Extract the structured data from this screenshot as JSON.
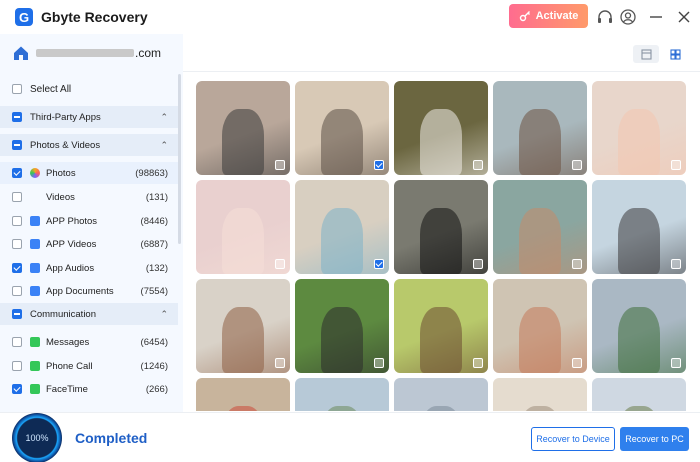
{
  "app": {
    "title": "Gbyte Recovery",
    "logo_letter": "G"
  },
  "titlebar": {
    "activate_label": "Activate",
    "icons": [
      "key-icon",
      "headset-icon",
      "user-icon",
      "minimize-icon",
      "close-icon"
    ]
  },
  "account": {
    "email_suffix": ".com"
  },
  "view": {
    "modes": [
      "list-view-icon",
      "grid-view-icon"
    ],
    "active": "grid"
  },
  "sidebar": {
    "select_all": "Select All",
    "categories": [
      {
        "label": "Third-Party Apps",
        "state": "partial",
        "expanded": true,
        "items": []
      },
      {
        "label": "Photos & Videos",
        "state": "partial",
        "expanded": true,
        "items": [
          {
            "label": "Photos",
            "count": "(98863)",
            "checked": true,
            "icon": "photos-icon",
            "color": "#f5a623"
          },
          {
            "label": "Videos",
            "count": "(131)",
            "checked": false,
            "icon": "",
            "color": ""
          },
          {
            "label": "APP Photos",
            "count": "(8446)",
            "checked": false,
            "icon": "app-photos-icon",
            "color": "#3b82f6"
          },
          {
            "label": "APP Videos",
            "count": "(6887)",
            "checked": false,
            "icon": "app-videos-icon",
            "color": "#3b82f6"
          },
          {
            "label": "App Audios",
            "count": "(132)",
            "checked": true,
            "icon": "app-audios-icon",
            "color": "#3b82f6"
          },
          {
            "label": "App Documents",
            "count": "(7554)",
            "checked": false,
            "icon": "app-documents-icon",
            "color": "#3b82f6"
          }
        ]
      },
      {
        "label": "Communication",
        "state": "partial",
        "expanded": true,
        "items": [
          {
            "label": "Messages",
            "count": "(6454)",
            "checked": false,
            "icon": "messages-icon",
            "color": "#34c759"
          },
          {
            "label": "Phone Call",
            "count": "(1246)",
            "checked": false,
            "icon": "phone-call-icon",
            "color": "#34c759"
          },
          {
            "label": "FaceTime",
            "count": "(266)",
            "checked": true,
            "icon": "facetime-icon",
            "color": "#34c759"
          }
        ]
      }
    ]
  },
  "photos": [
    {
      "checked": false,
      "bg": "#b9a79a",
      "accent": "#3b3b3b"
    },
    {
      "checked": true,
      "bg": "#d8c9b6",
      "accent": "#5b4f46"
    },
    {
      "checked": false,
      "bg": "#6b6640",
      "accent": "#f1ede7"
    },
    {
      "checked": false,
      "bg": "#a9b8bd",
      "accent": "#6d5241"
    },
    {
      "checked": false,
      "bg": "#e8d6cb",
      "accent": "#f3c6b1"
    },
    {
      "checked": false,
      "bg": "#e9d0cf",
      "accent": "#f6dfd7"
    },
    {
      "checked": true,
      "bg": "#d8cfc1",
      "accent": "#7db2c9"
    },
    {
      "checked": false,
      "bg": "#7a7a70",
      "accent": "#121212"
    },
    {
      "checked": false,
      "bg": "#8aa6a0",
      "accent": "#c58b6a"
    },
    {
      "checked": false,
      "bg": "#c5d5e0",
      "accent": "#3c3b3d"
    },
    {
      "checked": false,
      "bg": "#d9d2c8",
      "accent": "#8e5f44"
    },
    {
      "checked": false,
      "bg": "#5d8a40",
      "accent": "#2b2b2b"
    },
    {
      "checked": false,
      "bg": "#b8c96b",
      "accent": "#6b4a32"
    },
    {
      "checked": false,
      "bg": "#cfc4b3",
      "accent": "#c47a5a"
    },
    {
      "checked": false,
      "bg": "#aab8c4",
      "accent": "#3e6e3a"
    },
    {
      "checked": false,
      "bg": "#c8b49c",
      "accent": "#cc4b3a"
    },
    {
      "checked": false,
      "bg": "#b7c9d7",
      "accent": "#6e8a5d"
    },
    {
      "checked": false,
      "bg": "#bcc7d3",
      "accent": "#7b8b99"
    },
    {
      "checked": false,
      "bg": "#e5dccf",
      "accent": "#9e8e7b"
    },
    {
      "checked": false,
      "bg": "#cfd8e2",
      "accent": "#6b7e4b"
    }
  ],
  "footer": {
    "progress_text": "100%",
    "progress": 100,
    "status": "Completed",
    "recover_device_label": "Recover to Device",
    "recover_pc_label": "Recover to PC"
  }
}
